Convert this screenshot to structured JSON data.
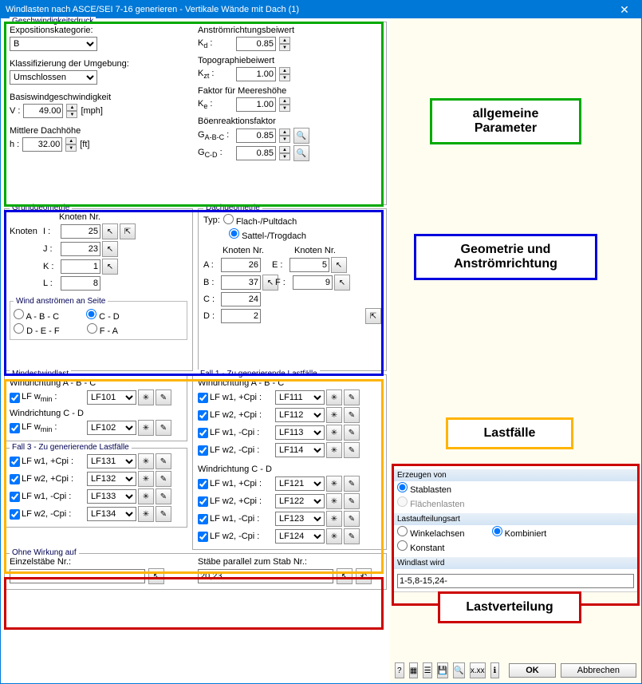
{
  "window": {
    "title": "Windlasten nach ASCE/SEI 7-16 generieren - Vertikale Wände mit Dach   (1)",
    "close": "✕"
  },
  "velocity": {
    "title": "Geschwindigkeitsdruck",
    "exposure_lbl": "Expositionskategorie:",
    "exposure_val": "B",
    "enclosure_lbl": "Klassifizierung der Umgebung:",
    "enclosure_val": "Umschlossen",
    "basic_wind_lbl": "Basiswindgeschwindigkeit",
    "v_lbl": "V :",
    "v_val": "49.00",
    "v_unit": "[mph]",
    "roof_h_lbl": "Mittlere Dachhöhe",
    "h_lbl": "h :",
    "h_val": "32.00",
    "h_unit": "[ft]",
    "kd_title": "Anströmrichtungsbeiwert",
    "kd_lbl": "Kd :",
    "kd_val": "0.85",
    "kzt_title": "Topographiebeiwert",
    "kzt_lbl": "Kzt :",
    "kzt_val": "1.00",
    "ke_title": "Faktor für Meereshöhe",
    "ke_lbl": "Ke :",
    "ke_val": "1.00",
    "gust_title": "Böenreaktionsfaktor",
    "gabc_lbl": "GA-B-C :",
    "gabc_val": "0.85",
    "gcd_lbl": "GC-D :",
    "gcd_val": "0.85"
  },
  "geom": {
    "base_title": "Grundgeometrie",
    "node_hdr": "Knoten Nr.",
    "nodes_lbl": "Knoten",
    "I": "25",
    "J": "23",
    "K": "1",
    "L": "8",
    "roof_title": "Dachgeometrie",
    "type_lbl": "Typ:",
    "type_flat": "Flach-/Pultdach",
    "type_gable": "Sattel-/Trogdach",
    "A": "26",
    "B": "37",
    "C": "24",
    "D": "2",
    "E": "5",
    "F": "9",
    "wind_side_title": "Wind anströmen an Seite",
    "s_abc": "A - B - C",
    "s_cd": "C - D",
    "s_def": "D - E - F",
    "s_fa": "F - A"
  },
  "loadcases": {
    "min_title": "Mindestwindlast",
    "dir_abc": "Windrichtung A - B - C",
    "dir_cd": "Windrichtung C - D",
    "wmin_lbl": "LF wmin :",
    "lf101": "LF101",
    "lf102": "LF102",
    "case1_title": "Fall 1 - Zu generierende Lastfälle",
    "case3_title": "Fall 3 - Zu generierende Lastfälle",
    "w1p": "LF w1, +Cpi :",
    "w2p": "LF w2, +Cpi :",
    "w1n": "LF w1, -Cpi :",
    "w2n": "LF w2, -Cpi :",
    "lf111": "LF111",
    "lf112": "LF112",
    "lf113": "LF113",
    "lf114": "LF114",
    "lf121": "LF121",
    "lf122": "LF122",
    "lf123": "LF123",
    "lf124": "LF124",
    "lf131": "LF131",
    "lf132": "LF132",
    "lf133": "LF133",
    "lf134": "LF134"
  },
  "noeffect": {
    "title": "Ohne Wirkung auf",
    "single_lbl": "Einzelstäbe Nr.:",
    "parallel_lbl": "Stäbe parallel zum Stab Nr.:",
    "parallel_val": "20,23"
  },
  "right": {
    "gen_title": "Erzeugen von",
    "member": "Stablasten",
    "area": "Flächenlasten",
    "dist_title": "Lastaufteilungsart",
    "axis": "Winkelachsen",
    "comb": "Kombiniert",
    "const": "Konstant",
    "apply_title": "Windlast wird",
    "apply_val": "1-5,8-15,24-"
  },
  "callouts": {
    "c1": "allgemeine Parameter",
    "c2": "Geometrie und Anströmrichtung",
    "c3": "Lastfälle",
    "c4": "Lastverteilung"
  },
  "buttons": {
    "ok": "OK",
    "cancel": "Abbrechen"
  }
}
